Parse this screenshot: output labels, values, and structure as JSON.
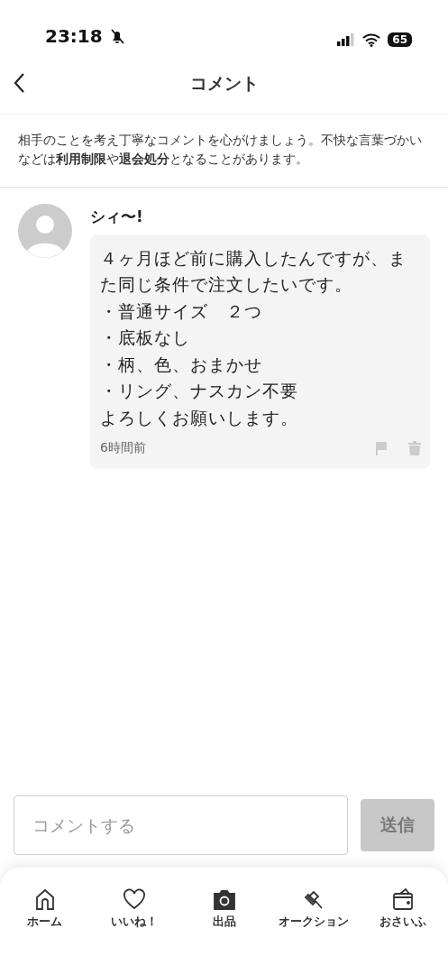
{
  "status_bar": {
    "time": "23:18",
    "battery": "65"
  },
  "header": {
    "title": "コメント"
  },
  "notice": "相手のことを考え丁寧なコメントを心がけましょう。不快な言葉づかいなどは**利用制限**や**退会処分**となることがあります。",
  "comments": [
    {
      "author": "シィ〜!",
      "body": [
        "４ヶ月ほど前に購入したんですが、また同じ条件で注文したいです。",
        "・普通サイズ　２つ",
        "・底板なし",
        "・柄、色、おまかせ",
        "・リング、ナスカン不要",
        "よろしくお願いします。"
      ],
      "time": "6時間前"
    }
  ],
  "composer": {
    "placeholder": "コメントする",
    "send": "送信",
    "disabled": true
  },
  "tab_bar": [
    {
      "kind": "home",
      "label": "ホーム"
    },
    {
      "kind": "like",
      "label": "いいね！"
    },
    {
      "kind": "sell",
      "label": "出品"
    },
    {
      "kind": "auction",
      "label": "オークション"
    },
    {
      "kind": "wallet",
      "label": "おさいふ"
    }
  ]
}
